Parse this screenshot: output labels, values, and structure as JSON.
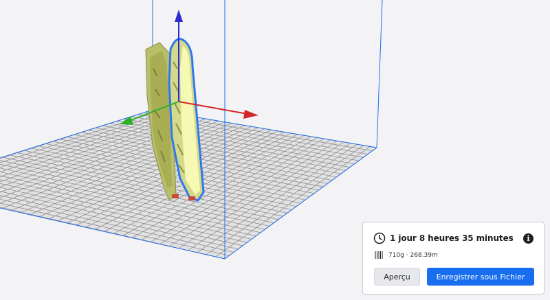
{
  "window": {
    "background_color": "#f3f3f5"
  },
  "viewport": {
    "build_plate_grid_color": "#8e8e8e",
    "build_volume_edge_color": "#1e6ef0",
    "model_fill_color": "#d5d98a",
    "model_highlight_color": "#f5f9b4",
    "model_outline_color": "#2d78f0",
    "axis_colors": {
      "x": "#d02828",
      "y": "#2bb12b",
      "z": "#2b2bd0"
    }
  },
  "print_summary": {
    "clock_icon": "clock-icon",
    "estimated_time": "1 jour 8 heures 35 minutes",
    "info_icon": "info-icon",
    "info_glyph": "i",
    "material_icon": "filament-spool-icon",
    "material_usage": "710g · 268.39m",
    "preview_button_label": "Aperçu",
    "save_button_label": "Enregistrer sous Fichier",
    "accent_color": "#196ef0"
  }
}
